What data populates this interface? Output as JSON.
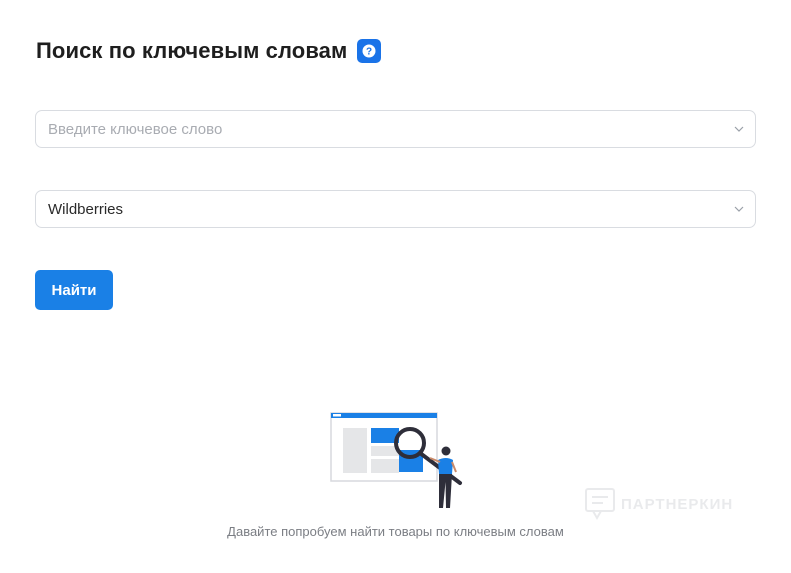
{
  "header": {
    "title": "Поиск по ключевым словам",
    "help_icon": "question-circle-icon"
  },
  "keyword_select": {
    "placeholder": "Введите ключевое слово",
    "value": ""
  },
  "marketplace_select": {
    "value": "Wildberries"
  },
  "find_button": {
    "label": "Найти"
  },
  "empty_state": {
    "message": "Давайте попробуем найти товары по ключевым словам"
  },
  "watermark": {
    "text": "ПАРТНЕРКИН"
  },
  "colors": {
    "accent": "#1a80e6",
    "border": "#d9dce1",
    "placeholder": "#a9acb2",
    "muted_text": "#7b7e84"
  }
}
